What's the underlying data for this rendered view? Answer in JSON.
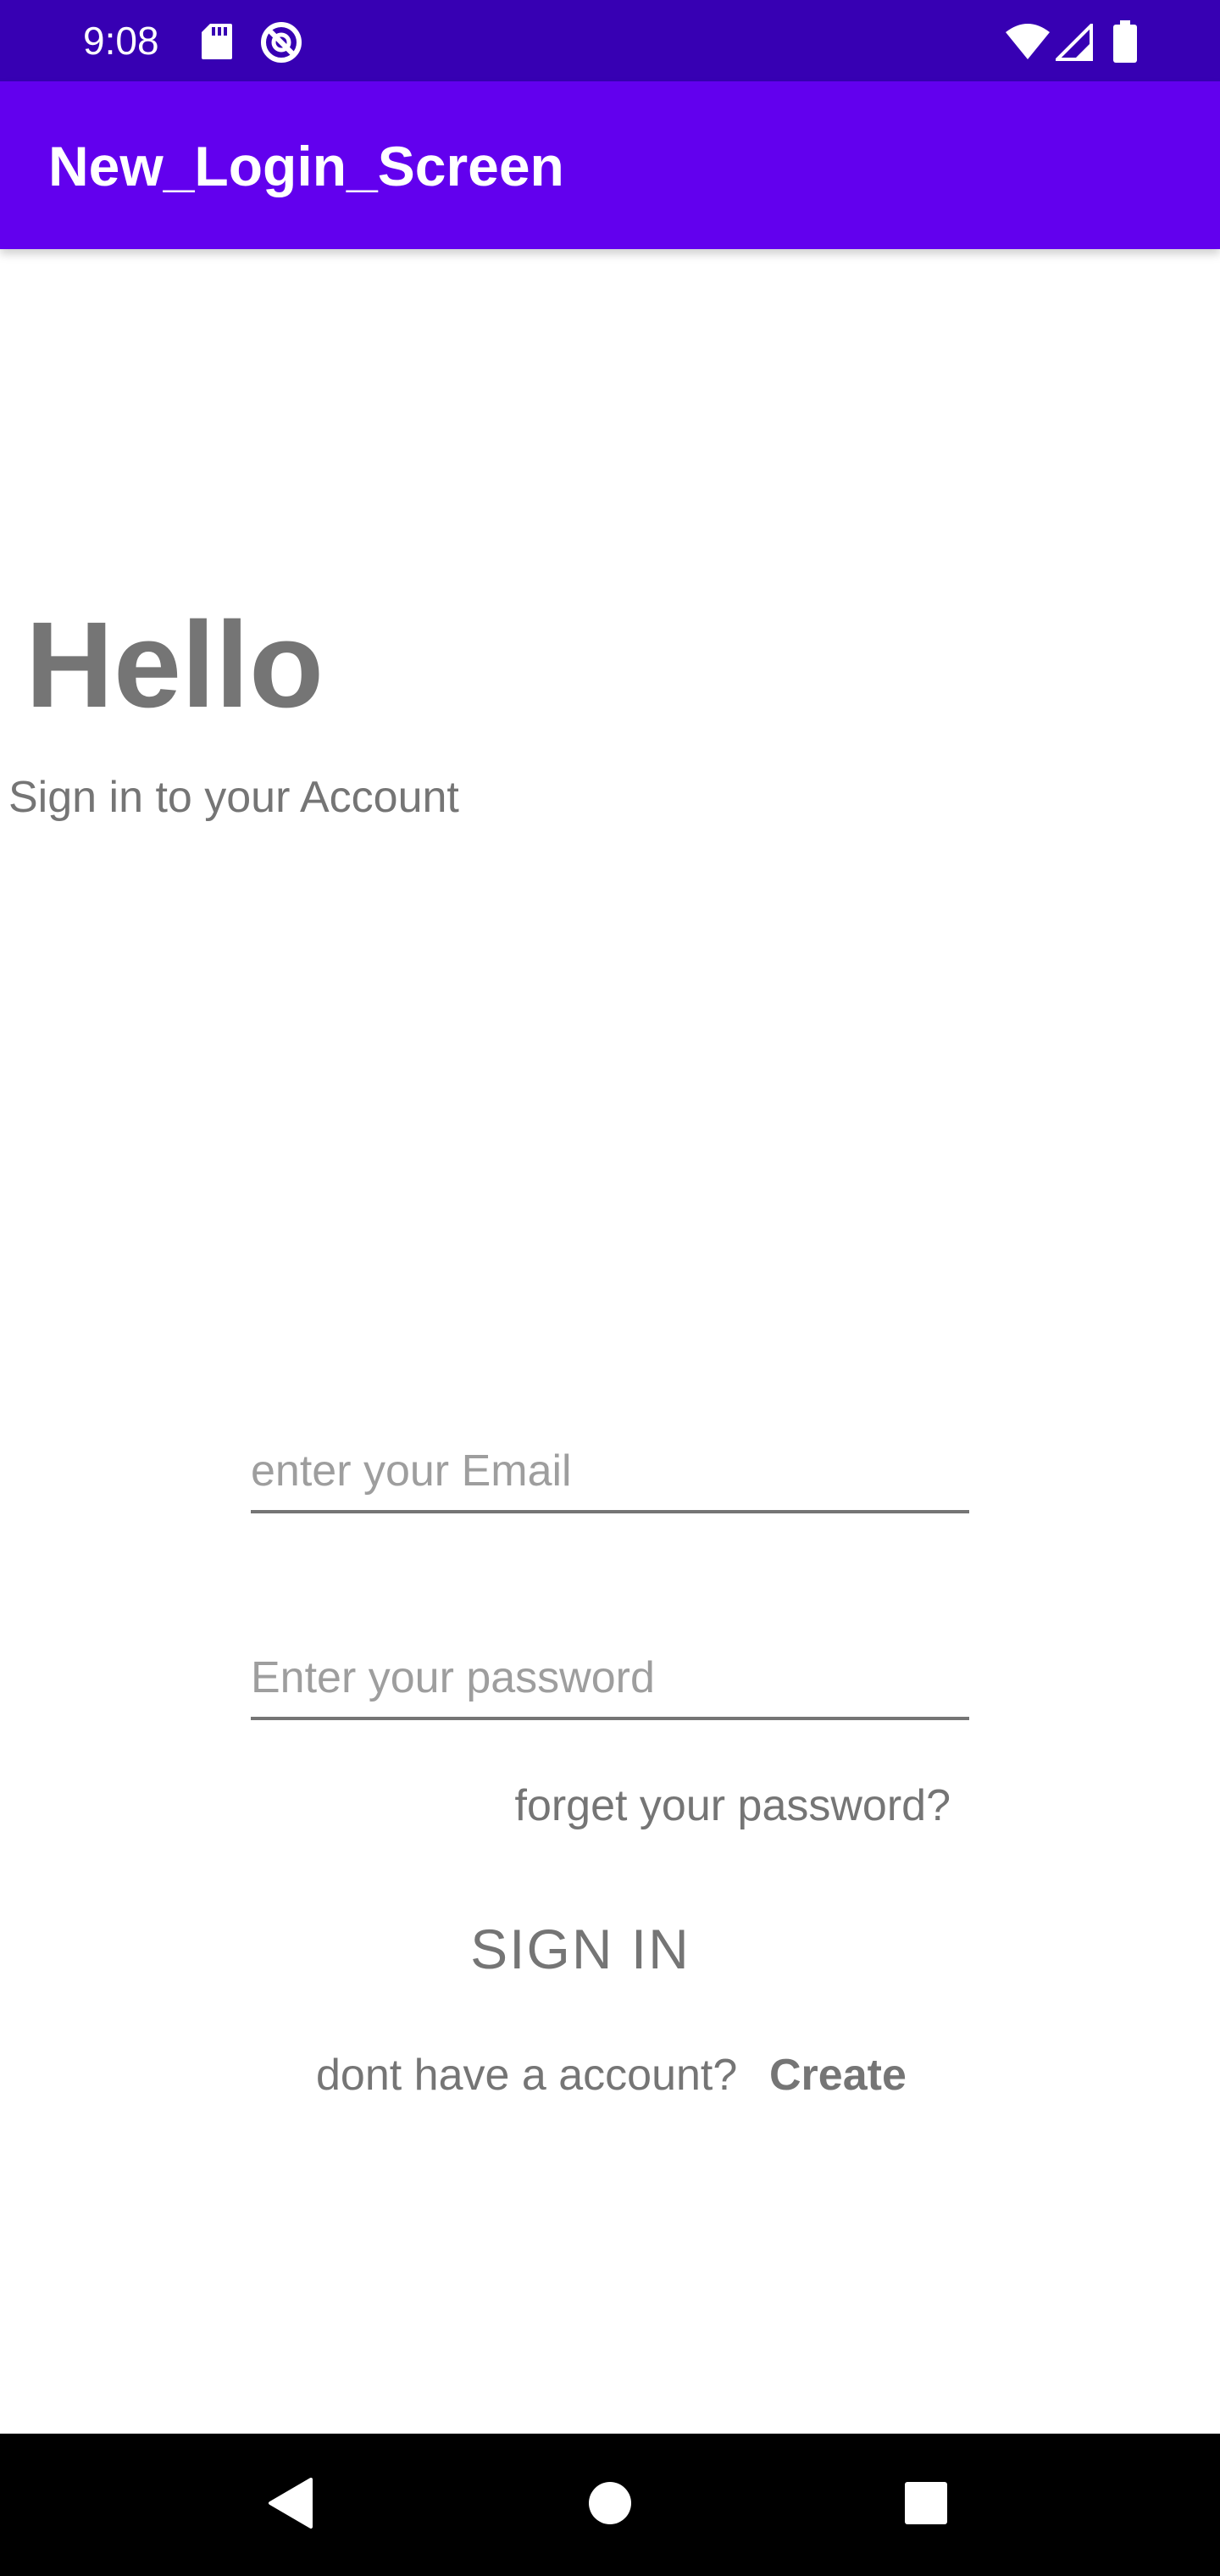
{
  "status_bar": {
    "time": "9:08",
    "icons_left": [
      "sd-card-icon",
      "data-saver-icon"
    ],
    "icons_right": [
      "wifi-icon",
      "cell-signal-icon",
      "battery-icon"
    ],
    "background": "#3700B3"
  },
  "app_bar": {
    "title": "New_Login_Screen",
    "background": "#6200EE"
  },
  "greeting": {
    "title": "Hello",
    "subtitle": "Sign in to your Account"
  },
  "form": {
    "email_placeholder": "enter your Email",
    "email_value": "",
    "password_placeholder": "Enter your password",
    "password_value": "",
    "forgot_label": "forget your password?",
    "signin_label": "SIGN IN",
    "no_account_text": "dont have a account?",
    "create_label": "Create"
  },
  "nav_bar": {
    "buttons": [
      "back-icon",
      "home-icon",
      "recents-icon"
    ]
  },
  "colors": {
    "primary": "#6200EE",
    "primary_dark": "#3700B3",
    "text_gray": "#757575"
  }
}
